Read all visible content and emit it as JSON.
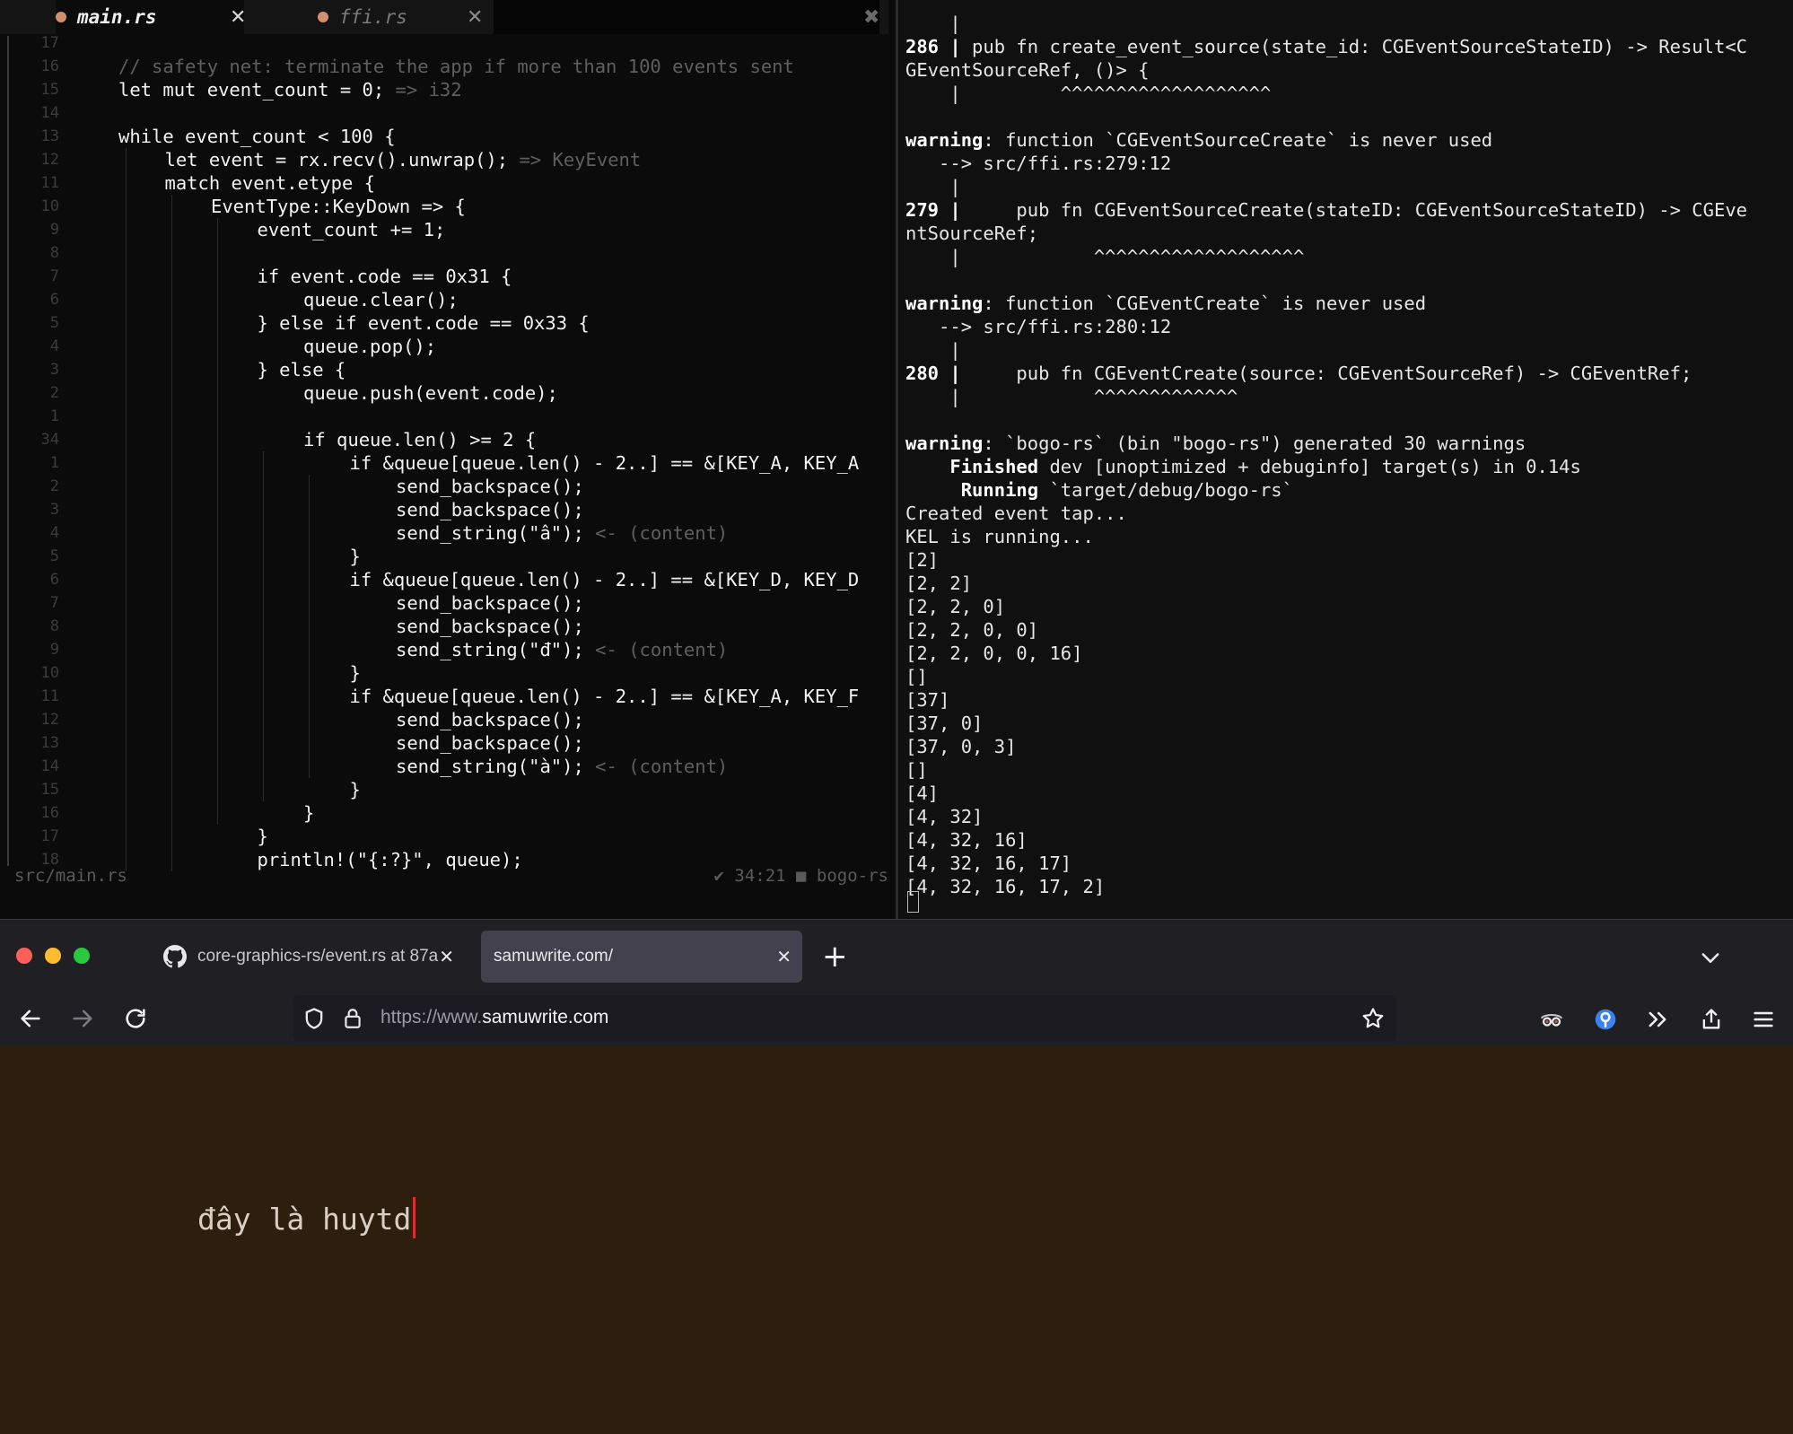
{
  "editor": {
    "tabs": [
      {
        "name": "main.rs",
        "close": "✕"
      },
      {
        "name": "ffi.rs",
        "close": "✕"
      },
      {
        "name": "",
        "close": "✖"
      }
    ],
    "lines": [
      {
        "ln": "17",
        "indent": 0,
        "text": "",
        "hint": ""
      },
      {
        "ln": "16",
        "indent": 0,
        "text": "",
        "comment": "// safety net: terminate the app if more than 100 events sent",
        "hint": ""
      },
      {
        "ln": "15",
        "indent": 0,
        "text": "let mut event_count = 0;",
        "hint": " => i32"
      },
      {
        "ln": "14",
        "indent": 0,
        "text": "",
        "hint": ""
      },
      {
        "ln": "13",
        "indent": 0,
        "text": "while event_count < 100 {",
        "hint": ""
      },
      {
        "ln": "12",
        "indent": 1,
        "text": "let event = rx.recv().unwrap();",
        "hint": " => KeyEvent"
      },
      {
        "ln": "11",
        "indent": 1,
        "text": "match event.etype {",
        "hint": ""
      },
      {
        "ln": "10",
        "indent": 2,
        "text": "EventType::KeyDown => {",
        "hint": ""
      },
      {
        "ln": "9",
        "indent": 3,
        "text": "event_count += 1;",
        "hint": ""
      },
      {
        "ln": "8",
        "indent": 0,
        "text": "",
        "hint": ""
      },
      {
        "ln": "7",
        "indent": 3,
        "text": "if event.code == 0x31 {",
        "hint": ""
      },
      {
        "ln": "6",
        "indent": 4,
        "text": "queue.clear();",
        "hint": ""
      },
      {
        "ln": "5",
        "indent": 3,
        "text": "} else if event.code == 0x33 {",
        "hint": ""
      },
      {
        "ln": "4",
        "indent": 4,
        "text": "queue.pop();",
        "hint": ""
      },
      {
        "ln": "3",
        "indent": 3,
        "text": "} else {",
        "hint": ""
      },
      {
        "ln": "2",
        "indent": 4,
        "text": "queue.push(event.code);",
        "hint": ""
      },
      {
        "ln": "1",
        "indent": 0,
        "text": "",
        "hint": ""
      },
      {
        "ln": "34",
        "indent": 4,
        "text": "if queue.len() >= 2 {",
        "hint": ""
      },
      {
        "ln": "1",
        "indent": 5,
        "text": "if &queue[queue.len() - 2..] == &[KEY_A, KEY_A",
        "hint": ""
      },
      {
        "ln": "2",
        "indent": 6,
        "text": "send_backspace();",
        "hint": ""
      },
      {
        "ln": "3",
        "indent": 6,
        "text": "send_backspace();",
        "hint": ""
      },
      {
        "ln": "4",
        "indent": 6,
        "text": "send_string(\"â\");",
        "hint": " <- (content)"
      },
      {
        "ln": "5",
        "indent": 5,
        "text": "}",
        "hint": ""
      },
      {
        "ln": "6",
        "indent": 5,
        "text": "if &queue[queue.len() - 2..] == &[KEY_D, KEY_D",
        "hint": ""
      },
      {
        "ln": "7",
        "indent": 6,
        "text": "send_backspace();",
        "hint": ""
      },
      {
        "ln": "8",
        "indent": 6,
        "text": "send_backspace();",
        "hint": ""
      },
      {
        "ln": "9",
        "indent": 6,
        "text": "send_string(\"đ\");",
        "hint": " <- (content)"
      },
      {
        "ln": "10",
        "indent": 5,
        "text": "}",
        "hint": ""
      },
      {
        "ln": "11",
        "indent": 5,
        "text": "if &queue[queue.len() - 2..] == &[KEY_A, KEY_F",
        "hint": ""
      },
      {
        "ln": "12",
        "indent": 6,
        "text": "send_backspace();",
        "hint": ""
      },
      {
        "ln": "13",
        "indent": 6,
        "text": "send_backspace();",
        "hint": ""
      },
      {
        "ln": "14",
        "indent": 6,
        "text": "send_string(\"à\");",
        "hint": " <- (content)"
      },
      {
        "ln": "15",
        "indent": 5,
        "text": "}",
        "hint": ""
      },
      {
        "ln": "16",
        "indent": 4,
        "text": "}",
        "hint": ""
      },
      {
        "ln": "17",
        "indent": 3,
        "text": "}",
        "hint": ""
      },
      {
        "ln": "18",
        "indent": 3,
        "text": "println!(\"{:?}\", queue);",
        "hint": ""
      }
    ],
    "status": {
      "file": "src/main.rs",
      "right": "✔  34:21 ■ bogo-rs"
    }
  },
  "terminal": {
    "lines": [
      {
        "t": "    |"
      },
      {
        "b": "286 |",
        "t": " pub fn create_event_source(state_id: CGEventSourceStateID) -> Result<C"
      },
      {
        "t": "GEventSourceRef, ()> {"
      },
      {
        "t": "    |         ^^^^^^^^^^^^^^^^^^^"
      },
      {
        "t": ""
      },
      {
        "b": "warning",
        "t": ": function `CGEventSourceCreate` is never used"
      },
      {
        "t": "   --> src/ffi.rs:279:12"
      },
      {
        "t": "    |"
      },
      {
        "b": "279 |",
        "t": "     pub fn CGEventSourceCreate(stateID: CGEventSourceStateID) -> CGEve"
      },
      {
        "t": "ntSourceRef;"
      },
      {
        "t": "    |            ^^^^^^^^^^^^^^^^^^^"
      },
      {
        "t": ""
      },
      {
        "b": "warning",
        "t": ": function `CGEventCreate` is never used"
      },
      {
        "t": "   --> src/ffi.rs:280:12"
      },
      {
        "t": "    |"
      },
      {
        "b": "280 |",
        "t": "     pub fn CGEventCreate(source: CGEventSourceRef) -> CGEventRef;"
      },
      {
        "t": "    |            ^^^^^^^^^^^^^"
      },
      {
        "t": ""
      },
      {
        "b": "warning",
        "t": ": `bogo-rs` (bin \"bogo-rs\") generated 30 warnings"
      },
      {
        "b": "    Finished",
        "t": " dev [unoptimized + debuginfo] target(s) in 0.14s"
      },
      {
        "b": "     Running",
        "t": " `target/debug/bogo-rs`"
      },
      {
        "t": "Created event tap..."
      },
      {
        "t": "KEL is running..."
      },
      {
        "t": "[2]"
      },
      {
        "t": "[2, 2]"
      },
      {
        "t": "[2, 2, 0]"
      },
      {
        "t": "[2, 2, 0, 0]"
      },
      {
        "t": "[2, 2, 0, 0, 16]"
      },
      {
        "t": "[]"
      },
      {
        "t": "[37]"
      },
      {
        "t": "[37, 0]"
      },
      {
        "t": "[37, 0, 3]"
      },
      {
        "t": "[]"
      },
      {
        "t": "[4]"
      },
      {
        "t": "[4, 32]"
      },
      {
        "t": "[4, 32, 16]"
      },
      {
        "t": "[4, 32, 16, 17]"
      },
      {
        "t": "[4, 32, 16, 17, 2]"
      }
    ]
  },
  "browser": {
    "tabs": [
      {
        "label": "core-graphics-rs/event.rs at 87a",
        "icon": "github-icon",
        "close": "✕"
      },
      {
        "label": "samuwrite.com/",
        "close": "✕"
      }
    ],
    "new_tab": "+",
    "url_scheme": "https://www.",
    "url_host": "samuwrite.com",
    "content_text": "đây là huytd",
    "colors": {
      "content_bg": "#2e1e0e",
      "caret": "#d83030",
      "active_tab": "#42414d"
    }
  }
}
